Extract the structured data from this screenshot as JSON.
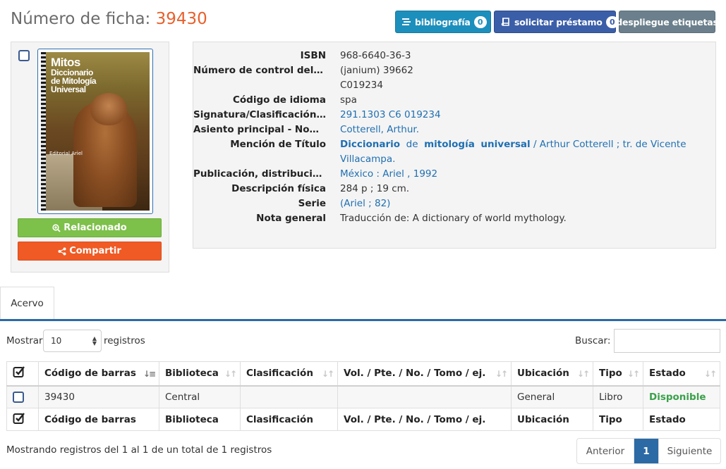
{
  "header": {
    "title_label": "Número de ficha:",
    "record_number": "39430"
  },
  "actions": {
    "bibliography_label": "bibliografía",
    "bibliography_count": "0",
    "loan_label": "solicitar préstamo",
    "loan_count": "0",
    "tags_label": "despliegue etiquetas"
  },
  "cover": {
    "title_line1": "Mitos",
    "title_line2": "Diccionario",
    "title_line3": "de Mitología",
    "title_line4": "Universal",
    "publisher": "Editorial Ariel"
  },
  "side_buttons": {
    "related_label": "Relacionado",
    "share_label": "Compartir"
  },
  "record": {
    "isbn_label": "ISBN",
    "isbn_value": "968-6640-36-3",
    "control_label": "Número de control del s...",
    "control_value1": "(janium) 39662",
    "control_value2": "C019234",
    "language_label": "Código de idioma",
    "language_value": "spa",
    "callnumber_label": "Signatura/Clasificación ...",
    "callnumber_value": "291.1303 C6 019234",
    "author_label": "Asiento principal - Nom...",
    "author_value": "Cotterell, Arthur.",
    "title_label": "Mención de Título",
    "title_w1": "Diccionario",
    "title_w2": "de",
    "title_w3": "mitología",
    "title_w4": "universal",
    "title_rest": "/ Arthur Cotterell ; tr. de Vicente",
    "title_rest2": "Villacampa.",
    "publication_label": "Publicación, distribució...",
    "publication_value": "México : Ariel , 1992",
    "physical_label": "Descripción física",
    "physical_value": "284 p ; 19 cm.",
    "series_label": "Serie",
    "series_value": "(Ariel ; 82)",
    "note_label": "Nota general",
    "note_value": "Traducción de: A dictionary of world mythology."
  },
  "tabs": {
    "holdings": "Acervo"
  },
  "table_controls": {
    "show_label": "Mostrar",
    "page_size": "10",
    "show_suffix": "registros",
    "search_label": "Buscar:",
    "search_value": ""
  },
  "table": {
    "columns": [
      "Código de barras",
      "Biblioteca",
      "Clasificación",
      "Vol. / Pte. / No. / Tomo / ej.",
      "Ubicación",
      "Tipo",
      "Estado"
    ],
    "rows": [
      {
        "barcode": "39430",
        "library": "Central",
        "classification": "",
        "volume": "",
        "location": "General",
        "type": "Libro",
        "status": "Disponible"
      }
    ],
    "status_color": "#3aa14a"
  },
  "footer": {
    "info": "Mostrando registros del 1 al 1 de un total de 1 registros",
    "prev": "Anterior",
    "current_page": "1",
    "next": "Siguiente"
  },
  "colors": {
    "accent": "#e8602c",
    "primary": "#2b6aa5",
    "link": "#1f6fb2"
  }
}
